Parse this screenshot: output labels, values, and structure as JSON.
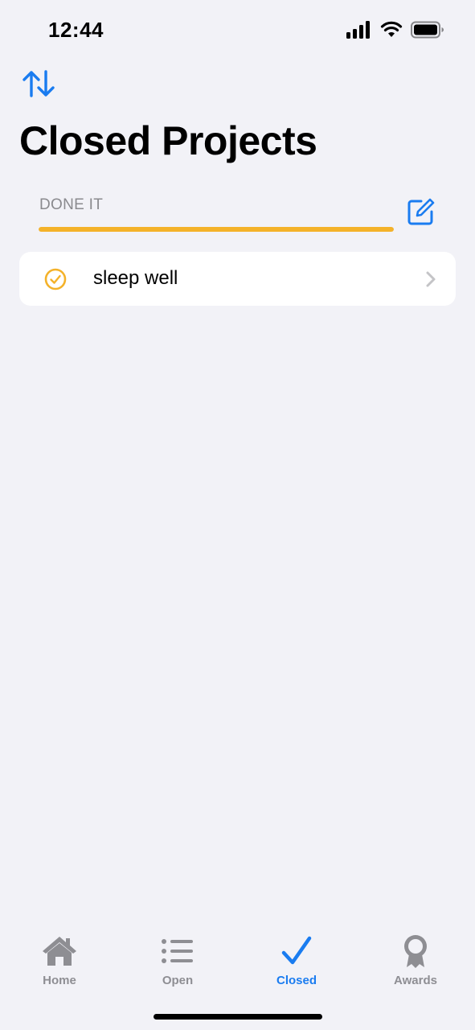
{
  "status_bar": {
    "time": "12:44",
    "icons": [
      "signal-icon",
      "wifi-icon",
      "battery-icon"
    ]
  },
  "toolbar": {
    "sort_icon": "arrow-up-down-icon",
    "edit_icon": "compose-icon"
  },
  "page": {
    "title": "Closed Projects"
  },
  "section": {
    "header": "DONE IT",
    "progress": 1.0,
    "progress_color": "#F4B22A"
  },
  "items": [
    {
      "label": "sleep well",
      "icon": "checkmark-circle-icon",
      "color": "#F4B22A"
    }
  ],
  "tabs": [
    {
      "label": "Home",
      "icon": "house-icon",
      "active": false
    },
    {
      "label": "Open",
      "icon": "list-icon",
      "active": false
    },
    {
      "label": "Closed",
      "icon": "checkmark-icon",
      "active": true
    },
    {
      "label": "Awards",
      "icon": "rosette-icon",
      "active": false
    }
  ],
  "colors": {
    "accent": "#1A7CF0",
    "background": "#F2F2F7",
    "inactive": "#8E8E93"
  }
}
